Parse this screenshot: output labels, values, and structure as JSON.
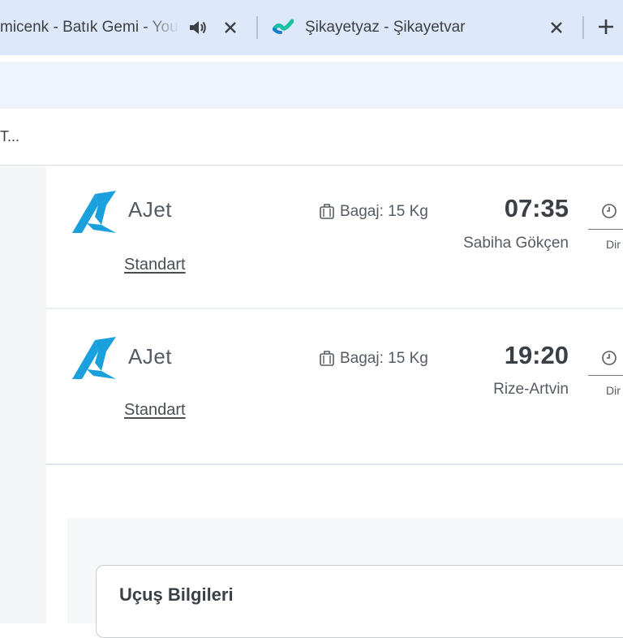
{
  "browser": {
    "tabs": [
      {
        "title": "micenk - Batık Gemi - YouTube",
        "audio": true
      },
      {
        "title": "Şikayetyaz - Şikayetvar",
        "audio": false
      }
    ],
    "bookmark_text": "T..."
  },
  "flights": [
    {
      "airline": "AJet",
      "fare": "Standart",
      "baggage": "Bagaj: 15 Kg",
      "time": "07:35",
      "airport": "Sabiha Gökçen",
      "duration_prefix": "Dir"
    },
    {
      "airline": "AJet",
      "fare": "Standart",
      "baggage": "Bagaj: 15 Kg",
      "time": "19:20",
      "airport": "Rize-Artvin",
      "duration_prefix": "Dir"
    }
  ],
  "section": {
    "title": "Uçuş Bilgileri"
  },
  "colors": {
    "tab_strip": "#dee8fb",
    "toolbar": "#eef3fd",
    "brand_blue": "#1aa0dc"
  }
}
